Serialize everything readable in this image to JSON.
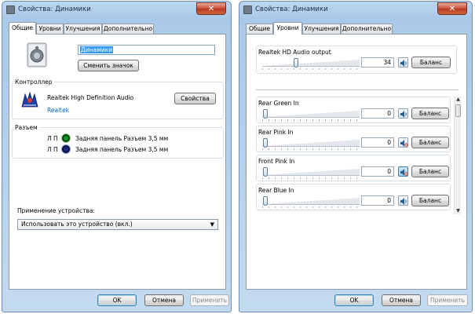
{
  "left_dialog": {
    "title": "Свойства: Динамики",
    "close_glyph": "✕",
    "tabs": [
      "Общие",
      "Уровни",
      "Улучшения",
      "Дополнительно"
    ],
    "device_name": "Динамики",
    "change_icon_label": "Сменить значок",
    "controller": {
      "group_label": "Контроллер",
      "name": "Realtek High Definition Audio",
      "vendor_link": "Realtek",
      "properties_label": "Свойства"
    },
    "jacks": {
      "group_label": "Разъем",
      "items": [
        {
          "channels": "Л П",
          "label": "Задняя панель Разъем 3,5 мм",
          "color": "#0a9a2a"
        },
        {
          "channels": "Л П",
          "label": "Задняя панель Разъем 3,5 мм",
          "color": "#1a2a8a"
        }
      ]
    },
    "usage_label": "Применение устройства:",
    "usage_value": "Использовать это устройство (вкл.)",
    "ok_label": "OK",
    "cancel_label": "Отмена",
    "apply_label": "Применить"
  },
  "right_dialog": {
    "title": "Свойства: Динамики",
    "close_glyph": "✕",
    "tabs": [
      "Общие",
      "Уровни",
      "Улучшения",
      "Дополнительно"
    ],
    "master": {
      "label": "Realtek HD Audio output",
      "value": "34",
      "level": 34,
      "balance_label": "Баланс"
    },
    "inputs": [
      {
        "label": "Rear Green In",
        "value": "0",
        "level": 0,
        "muted": false,
        "balance_label": "Баланс"
      },
      {
        "label": "Rear Pink In",
        "value": "0",
        "level": 0,
        "muted": true,
        "balance_label": "Баланс"
      },
      {
        "label": "Front Pink In",
        "value": "0",
        "level": 0,
        "muted": true,
        "balance_label": "Баланс"
      },
      {
        "label": "Rear Blue In",
        "value": "0",
        "level": 0,
        "muted": false,
        "balance_label": "Баланс"
      }
    ],
    "ok_label": "OK",
    "cancel_label": "Отмена",
    "apply_label": "Применить"
  }
}
